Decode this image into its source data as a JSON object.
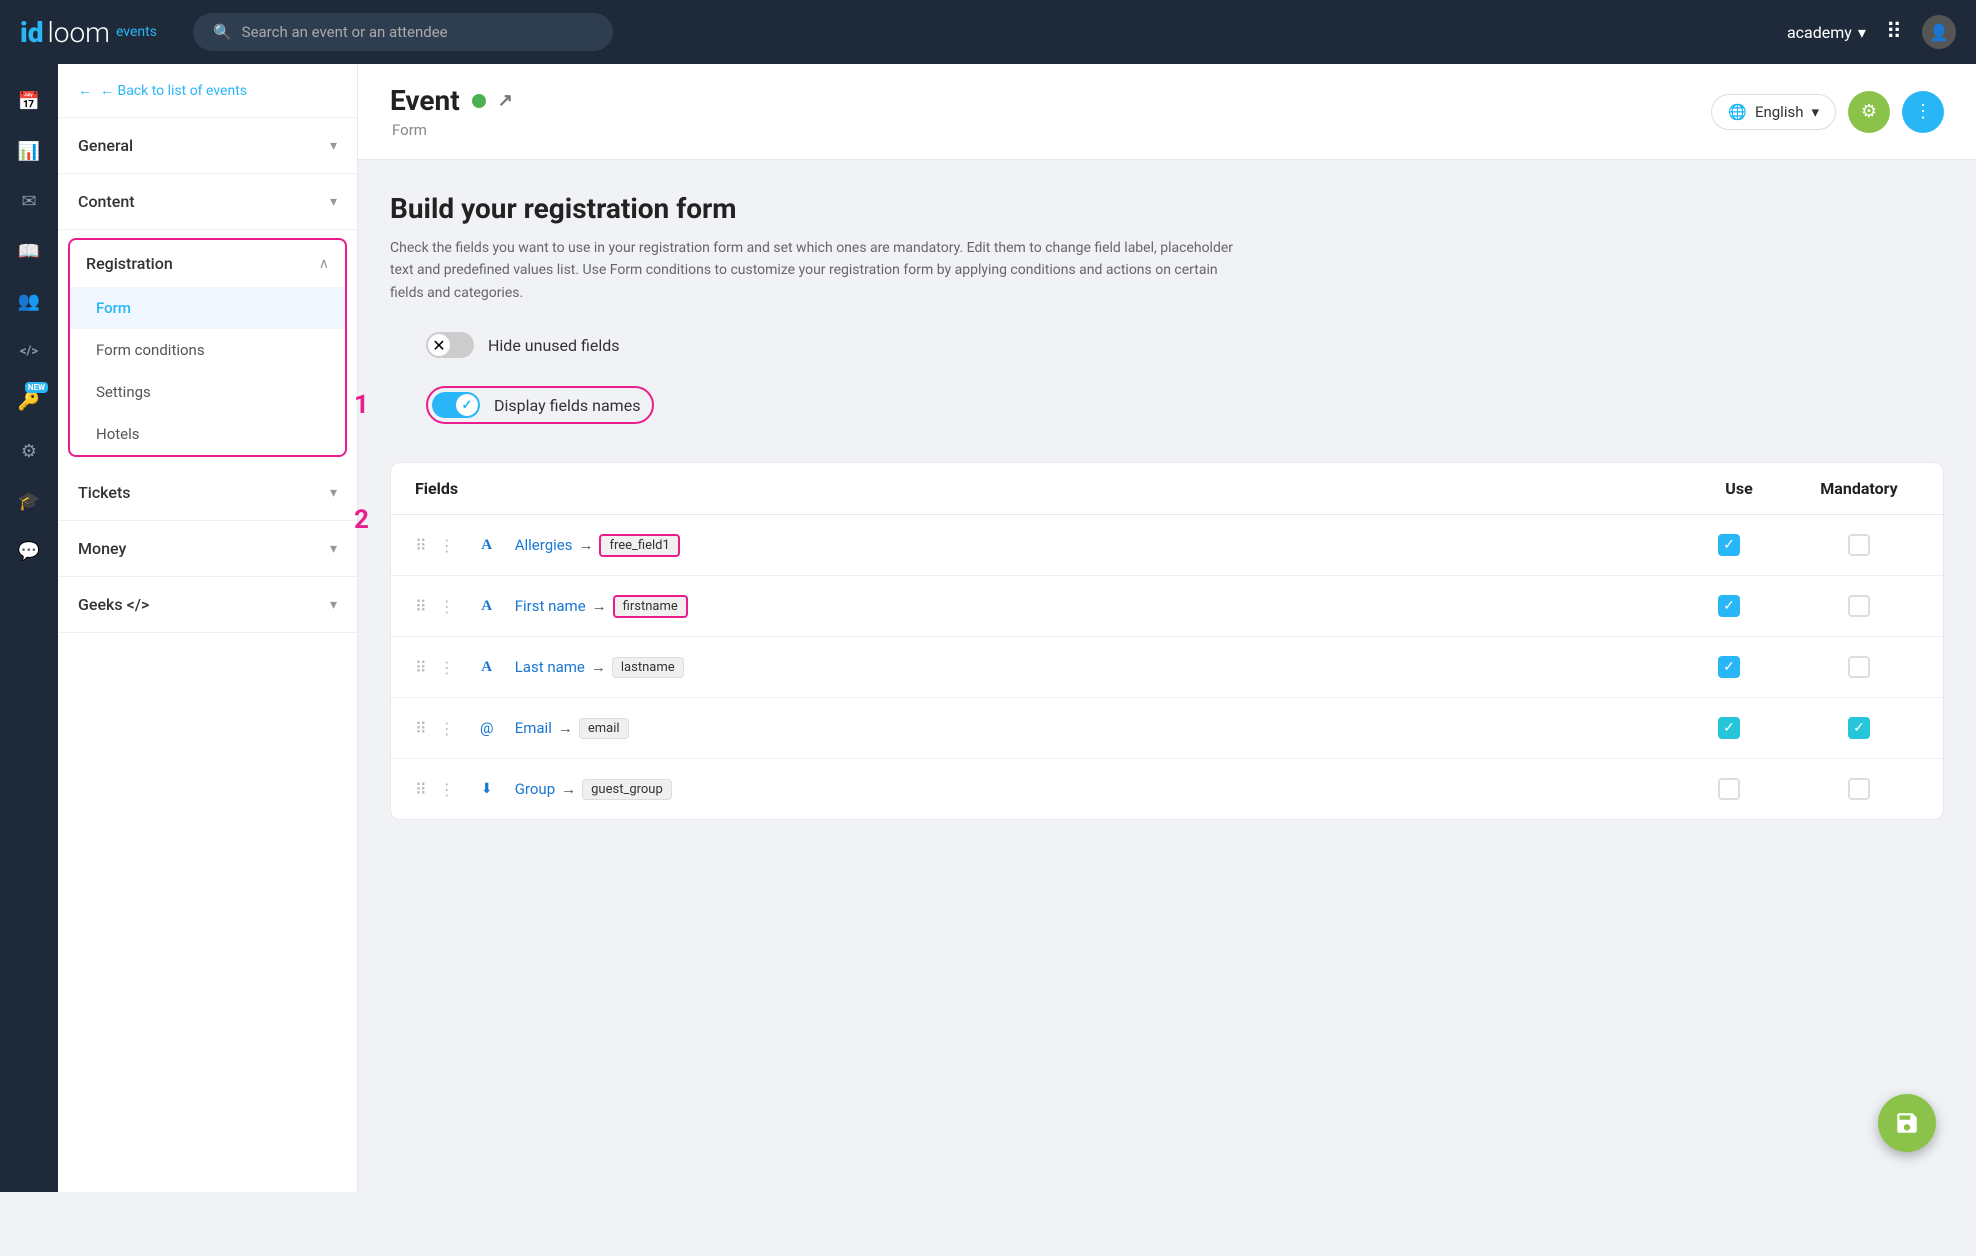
{
  "topnav": {
    "logo_id": "id",
    "logo_loom": "loom",
    "logo_events": "events",
    "search_placeholder": "Search an event or an attendee",
    "account_name": "academy",
    "chevron": "▾"
  },
  "sidebar": {
    "back_label": "← Back to list of events",
    "sections": [
      {
        "id": "general",
        "label": "General",
        "expanded": false
      },
      {
        "id": "content",
        "label": "Content",
        "expanded": false
      },
      {
        "id": "registration",
        "label": "Registration",
        "expanded": true,
        "highlighted": true,
        "items": [
          "Form",
          "Form conditions",
          "Settings",
          "Hotels"
        ]
      },
      {
        "id": "tickets",
        "label": "Tickets",
        "expanded": false
      },
      {
        "id": "money",
        "label": "Money",
        "expanded": false
      },
      {
        "id": "geeks",
        "label": "Geeks </>",
        "expanded": false
      }
    ]
  },
  "icon_nav": {
    "icons": [
      {
        "id": "calendar",
        "symbol": "📅"
      },
      {
        "id": "chart",
        "symbol": "📊"
      },
      {
        "id": "mail",
        "symbol": "✉"
      },
      {
        "id": "book",
        "symbol": "📖"
      },
      {
        "id": "users",
        "symbol": "👥"
      },
      {
        "id": "code",
        "symbol": "</>"
      },
      {
        "id": "key",
        "symbol": "🔑",
        "badge": "NEW"
      },
      {
        "id": "settings",
        "symbol": "⚙"
      },
      {
        "id": "graduation",
        "symbol": "🎓"
      },
      {
        "id": "chat",
        "symbol": "💬"
      }
    ]
  },
  "event_header": {
    "title": "Event",
    "subtitle": "Form",
    "language": "English",
    "status_color": "#4caf50"
  },
  "main": {
    "page_title": "Build your registration form",
    "page_desc": "Check the fields you want to use in your registration form and set which ones are mandatory. Edit them to change field label, placeholder text and predefined values list. Use Form conditions to customize your registration form by applying conditions and actions on certain fields and categories.",
    "toggle_hide_unused": {
      "label": "Hide unused fields",
      "state": "off"
    },
    "toggle_display_names": {
      "label": "Display fields names",
      "state": "on"
    },
    "table": {
      "col_fields": "Fields",
      "col_use": "Use",
      "col_mandatory": "Mandatory",
      "rows": [
        {
          "id": 1,
          "type_icon": "A",
          "type_class": "text",
          "name": "Allergies",
          "arrow": "→",
          "key": "free_field1",
          "use": true,
          "mandatory": false,
          "key_highlighted": true
        },
        {
          "id": 2,
          "type_icon": "A",
          "type_class": "text",
          "name": "First name",
          "arrow": "→",
          "key": "firstname",
          "use": true,
          "mandatory": false,
          "key_highlighted": true
        },
        {
          "id": 3,
          "type_icon": "A",
          "type_class": "text",
          "name": "Last name",
          "arrow": "→",
          "key": "lastname",
          "use": true,
          "mandatory": false,
          "key_highlighted": false
        },
        {
          "id": 4,
          "type_icon": "@",
          "type_class": "email",
          "name": "Email",
          "arrow": "→",
          "key": "email",
          "use": true,
          "mandatory": true,
          "key_highlighted": false
        },
        {
          "id": 5,
          "type_icon": "⬇",
          "type_class": "group",
          "name": "Group",
          "arrow": "→",
          "key": "guest_group",
          "use": false,
          "mandatory": false,
          "key_highlighted": false
        }
      ]
    }
  },
  "annotations": {
    "step1": "1",
    "step2": "2"
  },
  "save_fab_label": "💾"
}
